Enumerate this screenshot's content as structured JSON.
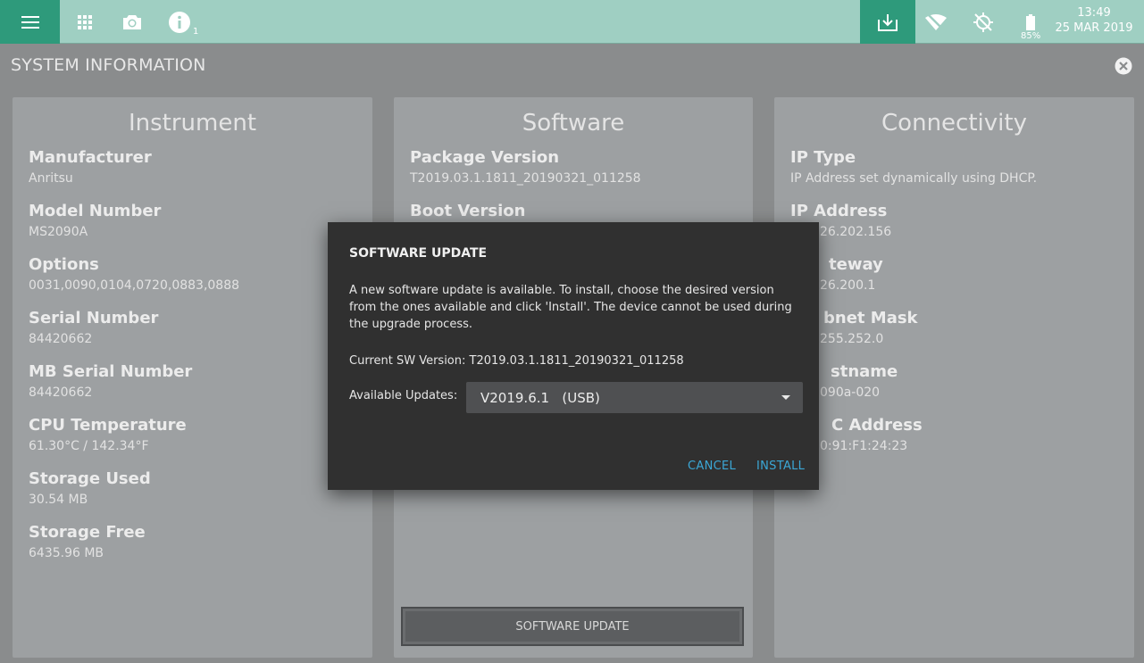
{
  "topbar": {
    "info_badge": "1",
    "battery_percent": "85%",
    "time": "13:49",
    "date": "25 MAR 2019"
  },
  "page": {
    "title": "SYSTEM INFORMATION"
  },
  "instrument": {
    "title": "Instrument",
    "fields": [
      {
        "label": "Manufacturer",
        "value": "Anritsu"
      },
      {
        "label": "Model Number",
        "value": "MS2090A"
      },
      {
        "label": "Options",
        "value": "0031,0090,0104,0720,0883,0888"
      },
      {
        "label": "Serial Number",
        "value": "84420662"
      },
      {
        "label": "MB Serial Number",
        "value": "84420662"
      },
      {
        "label": "CPU Temperature",
        "value": "61.30°C / 142.34°F"
      },
      {
        "label": "Storage Used",
        "value": "30.54 MB"
      },
      {
        "label": "Storage Free",
        "value": "6435.96 MB"
      }
    ]
  },
  "software": {
    "title": "Software",
    "fields": [
      {
        "label": "Package Version",
        "value": "T2019.03.1.1811_20190321_011258"
      },
      {
        "label": "Boot Version",
        "value": ""
      }
    ],
    "update_button": "SOFTWARE UPDATE"
  },
  "connectivity": {
    "title": "Connectivity",
    "fields": [
      {
        "label": "IP Type",
        "value": "IP Address set dynamically using DHCP."
      },
      {
        "label": "IP Address",
        "value": "26.202.156"
      },
      {
        "label": "teway",
        "value": "26.200.1"
      },
      {
        "label": "bnet Mask",
        "value": "255.252.0"
      },
      {
        "label": "stname",
        "value": "090a-020"
      },
      {
        "label": "C Address",
        "value": "0:91:F1:24:23"
      }
    ]
  },
  "dialog": {
    "title": "SOFTWARE UPDATE",
    "body": "A new software update is available. To install, choose the desired version from the ones available and click 'Install'. The device cannot be used during the upgrade process.",
    "current_version": "Current SW Version: T2019.03.1.1811_20190321_011258",
    "available_label": "Available Updates:",
    "selected_update": "V2019.6.1   (USB)",
    "cancel_label": "CANCEL",
    "install_label": "INSTALL"
  },
  "colors": {
    "topbar": "#9fcfc2",
    "accent": "#2e9a7b",
    "dialog_button": "#3ba7d6"
  }
}
